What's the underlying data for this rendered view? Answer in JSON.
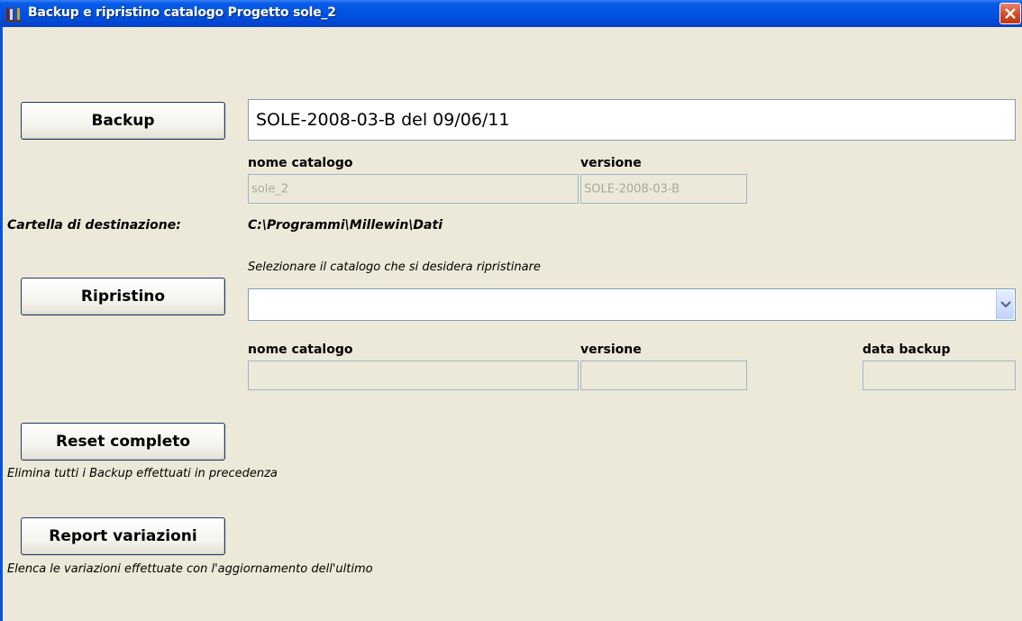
{
  "window": {
    "title": "Backup e ripristino catalogo Progetto sole_2",
    "app_icon": "catalog-books-icon",
    "close_icon": "close-icon"
  },
  "backup": {
    "button_label": "Backup",
    "current_value": "SOLE-2008-03-B del 09/06/11",
    "nome_label": "nome catalogo",
    "versione_label": "versione",
    "nome_value": "sole_2",
    "versione_value": "SOLE-2008-03-B"
  },
  "destination": {
    "label": "Cartella di destinazione:",
    "path": "C:\\Programmi\\Millewin\\Dati"
  },
  "restore": {
    "hint": "Selezionare il catalogo che si desidera ripristinare",
    "button_label": "Ripristino",
    "selected": "",
    "nome_label": "nome catalogo",
    "versione_label": "versione",
    "data_label": "data backup",
    "nome_value": "",
    "versione_value": "",
    "data_value": ""
  },
  "reset": {
    "button_label": "Reset completo",
    "description": "Elimina tutti i Backup effettuati in precedenza"
  },
  "report": {
    "button_label": "Report variazioni",
    "description": "Elenca le variazioni effettuate con l'aggiornamento dell'ultimo"
  },
  "colors": {
    "titlebar": "#0054e3",
    "background": "#ece9d8",
    "close_button": "#d2461d"
  }
}
